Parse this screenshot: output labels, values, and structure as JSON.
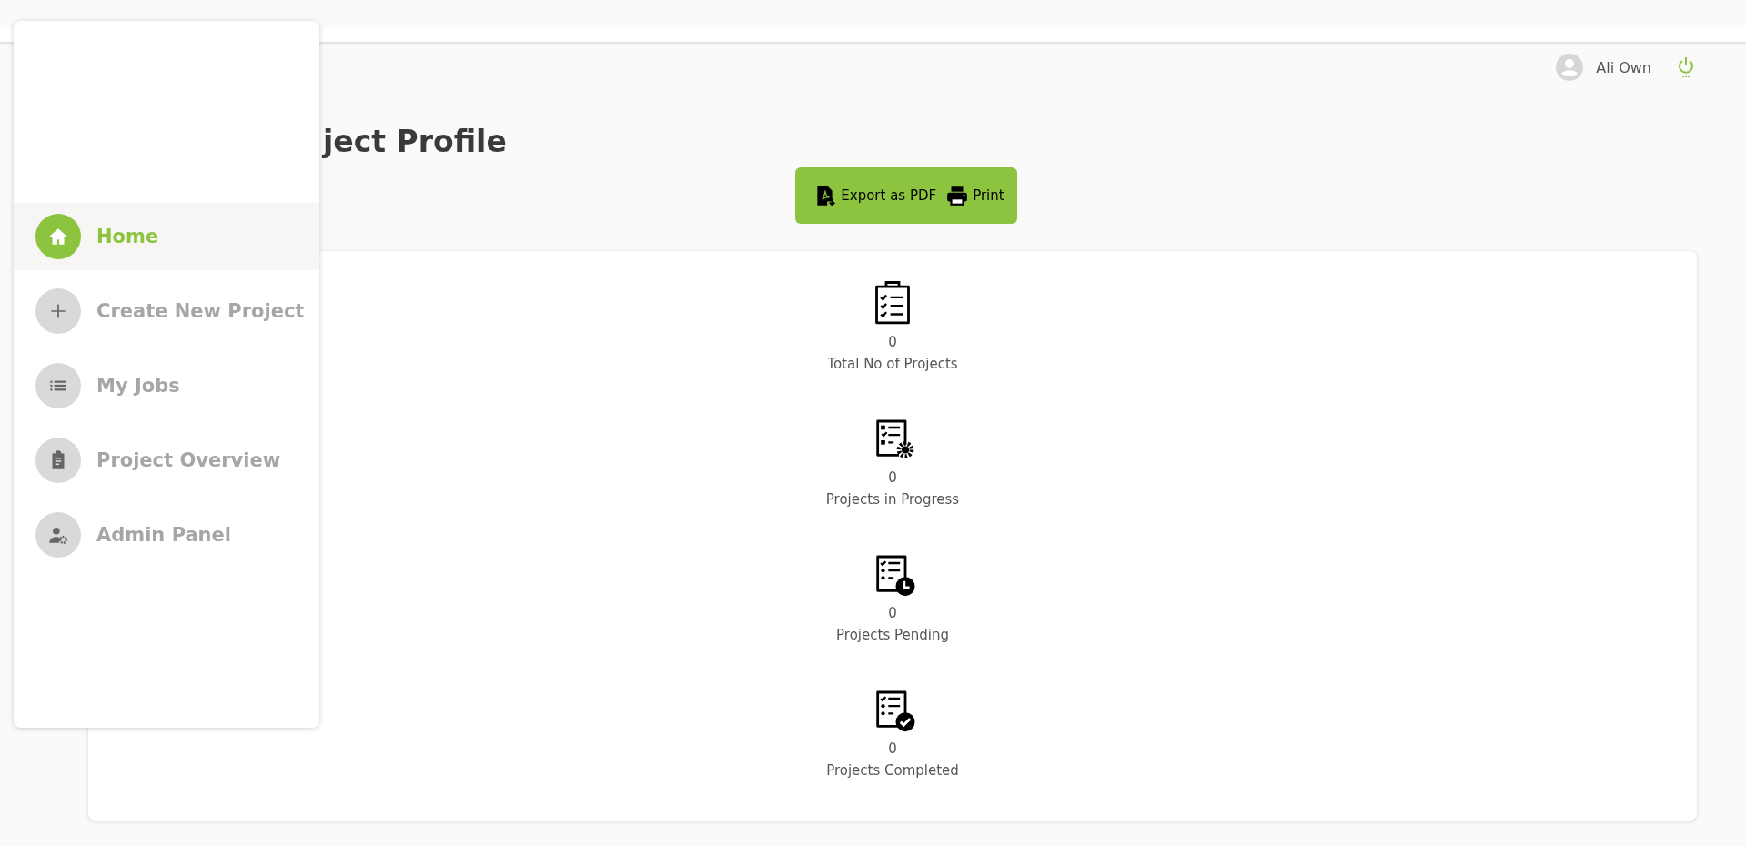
{
  "header": {
    "user_name": "Ali Own"
  },
  "page": {
    "title": "ject Profile",
    "buttons": [
      {
        "kind": "pdf",
        "label": "Export as PDF"
      },
      {
        "kind": "print",
        "label": "Print"
      }
    ]
  },
  "sidebar": {
    "items": [
      {
        "kind": "home",
        "label": "Home",
        "selected": true
      },
      {
        "kind": "plus",
        "label": "Create New Project",
        "selected": false
      },
      {
        "kind": "list",
        "label": "My Jobs",
        "selected": false
      },
      {
        "kind": "clipboard",
        "label": "Project Overview",
        "selected": false
      },
      {
        "kind": "admin",
        "label": "Admin Panel",
        "selected": false
      }
    ]
  },
  "stats": [
    {
      "kind": "total",
      "value": "0",
      "label": "Total No of Projects"
    },
    {
      "kind": "progress",
      "value": "0",
      "label": "Projects in Progress"
    },
    {
      "kind": "pending",
      "value": "0",
      "label": "Projects Pending"
    },
    {
      "kind": "completed",
      "value": "0",
      "label": "Projects Completed"
    }
  ]
}
